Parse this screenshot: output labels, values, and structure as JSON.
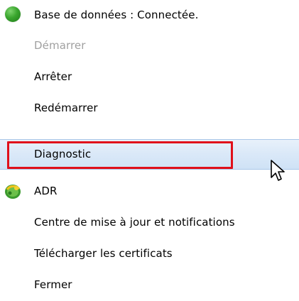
{
  "menu": {
    "items": [
      {
        "label": "Base de données : Connectée.",
        "icon": "green-status-dot-icon",
        "disabled": false
      },
      {
        "label": "Démarrer",
        "icon": null,
        "disabled": true
      },
      {
        "label": "Arrêter",
        "icon": null,
        "disabled": false
      },
      {
        "label": "Redémarrer",
        "icon": null,
        "disabled": false
      },
      {
        "label": "Diagnostic",
        "icon": null,
        "disabled": false,
        "highlighted": true
      },
      {
        "label": "ADR",
        "icon": "adr-icon",
        "disabled": false
      },
      {
        "label": "Centre de mise à jour et notifications",
        "icon": null,
        "disabled": false
      },
      {
        "label": "Télécharger les certificats",
        "icon": null,
        "disabled": false
      },
      {
        "label": "Fermer",
        "icon": null,
        "disabled": false
      }
    ]
  },
  "colors": {
    "highlight_box": "#e0101a",
    "hover_background": "#dbe9f8",
    "disabled_text": "#a0a0a0",
    "status_green": "#3aa62e"
  }
}
